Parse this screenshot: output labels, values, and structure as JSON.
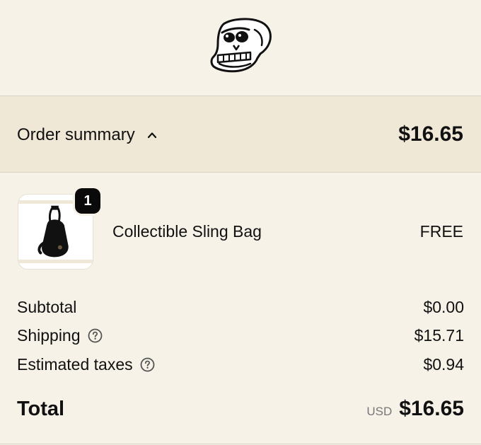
{
  "brand": {
    "logo_icon": "ape-skull-logo-icon"
  },
  "summary": {
    "toggle_label": "Order summary",
    "toggle_icon": "chevron-up-icon",
    "total": "$16.65"
  },
  "product": {
    "name": "Collectible Sling Bag",
    "price": "FREE",
    "quantity": "1",
    "image_icon": "sling-bag-icon"
  },
  "costs": {
    "subtotal_label": "Subtotal",
    "subtotal_value": "$0.00",
    "shipping_label": "Shipping",
    "shipping_value": "$15.71",
    "taxes_label": "Estimated taxes",
    "taxes_value": "$0.94",
    "help_icon": "question-circle-icon"
  },
  "total": {
    "label": "Total",
    "currency": "USD",
    "value": "$16.65"
  },
  "colors": {
    "page_bg": "#f6f2e8",
    "summary_bg": "#f0e8d6",
    "text": "#111111",
    "muted": "#777777"
  }
}
